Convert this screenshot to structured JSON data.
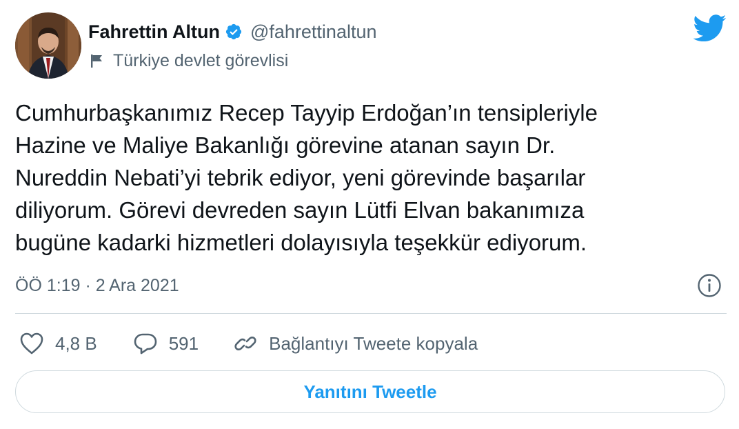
{
  "user": {
    "display_name": "Fahrettin Altun",
    "handle": "@fahrettinaltun",
    "label": "Türkiye devlet görevlisi"
  },
  "icons": {
    "verified": "verified-badge-icon",
    "flag": "flag-icon",
    "brand": "twitter-bird-icon",
    "info": "info-icon",
    "like": "heart-icon",
    "reply": "comment-icon",
    "copy": "link-icon"
  },
  "tweet": {
    "text_lines": [
      "Cumhurbaşkanımız Recep Tayyip Erdoğan’ın tensipleriyle",
      "Hazine ve Maliye Bakanlığı görevine atanan sayın Dr.",
      "Nureddin Nebati’yi tebrik ediyor, yeni görevinde başarılar",
      "diliyorum. Görevi devreden sayın Lütfi Elvan bakanımıza",
      "bugüne kadarki hizmetleri dolayısıyla teşekkür ediyorum."
    ],
    "timestamp": "ÖÖ 1:19 · 2 Ara 2021"
  },
  "actions": {
    "likes": "4,8 B",
    "replies": "591",
    "copy_link": "Bağlantıyı Tweete kopyala"
  },
  "reply_button": "Yanıtını Tweetle",
  "colors": {
    "accent": "#1d9bf0",
    "text": "#0f1419",
    "secondary": "#536471",
    "border": "#cfd9de"
  }
}
